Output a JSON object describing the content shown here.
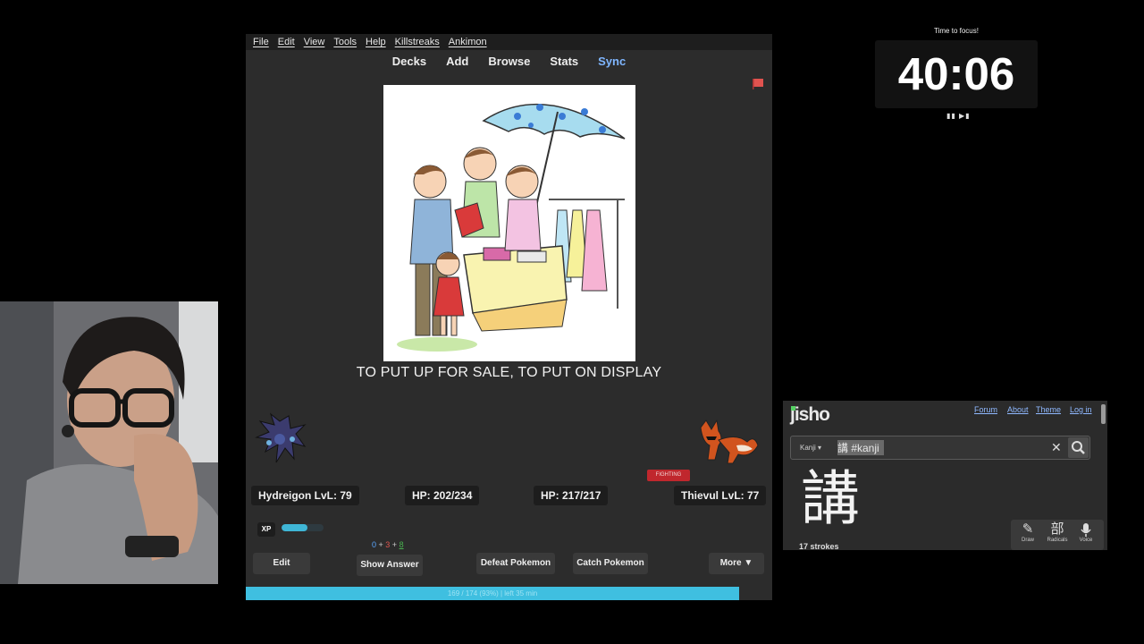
{
  "anki": {
    "menu": [
      "File",
      "Edit",
      "View",
      "Tools",
      "Help",
      "Killstreaks",
      "Ankimon"
    ],
    "toolbar": {
      "decks": "Decks",
      "add": "Add",
      "browse": "Browse",
      "stats": "Stats",
      "sync": "Sync"
    },
    "card": {
      "answer_text": "TO PUT UP FOR SALE, TO PUT ON DISPLAY"
    },
    "battle": {
      "player": {
        "name_level": "Hydreigon LvL: 79",
        "hp": "HP: 202/234"
      },
      "enemy": {
        "name_level": "Thievul LvL: 77",
        "hp": "HP: 217/217",
        "type": "FIGHTING"
      },
      "xp_label": "XP",
      "xp_fraction": 0.62
    },
    "counts": {
      "new": "0",
      "plus1": " + ",
      "learn": "3",
      "plus2": " + ",
      "review": "8"
    },
    "buttons": {
      "edit": "Edit",
      "show_answer": "Show Answer",
      "defeat": "Defeat Pokemon",
      "catch": "Catch Pokemon",
      "more": "More ▼"
    },
    "progress_text": "169 / 174 (93%) | left 35 min"
  },
  "timer": {
    "caption": "Time to focus!",
    "value": "40:06",
    "controls": "▮▮ ▶▮"
  },
  "jisho": {
    "logo": "jisho",
    "nav": {
      "forum": "Forum",
      "about": "About",
      "theme": "Theme",
      "login": "Log in"
    },
    "search": {
      "kind": "Kanji ▾",
      "value": "講 #kanji"
    },
    "kanji": "講",
    "strokes": "17 strokes",
    "tools": {
      "draw": "Draw",
      "radicals": "Radicals",
      "radicals_glyph": "部",
      "voice": "Voice"
    }
  },
  "colors": {
    "accent_blue": "#3fbfe0",
    "sync_blue": "#7fb6ff",
    "type_red": "#c0272d",
    "jisho_green": "#56d364"
  }
}
